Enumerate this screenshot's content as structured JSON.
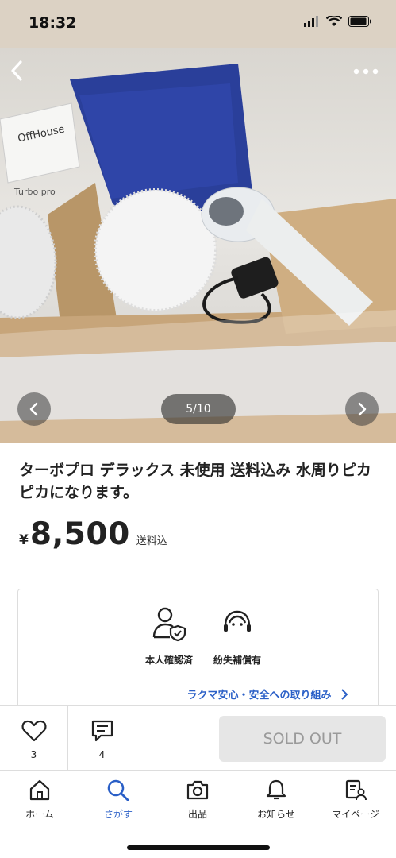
{
  "status_bar": {
    "time": "18:32"
  },
  "gallery": {
    "page_indicator": "5/10",
    "photo_text": {
      "logo_text": "OffHouse",
      "box_text": "Turbo pro"
    }
  },
  "item": {
    "title": "ターボプロ デラックス 未使用 送料込み 水周りピカピカになります。",
    "currency_symbol": "¥",
    "price": "8,500",
    "shipping_note": "送料込"
  },
  "safety": {
    "identity_label": "本人確認済",
    "compensation_label": "紛失補償有",
    "link_text": "ラクマ安心・安全への取り組み"
  },
  "actions": {
    "like_count": "3",
    "comment_count": "4",
    "sold_out_label": "SOLD OUT"
  },
  "tabs": {
    "home": "ホーム",
    "search": "さがす",
    "sell": "出品",
    "notifications": "お知らせ",
    "mypage": "マイページ"
  },
  "colors": {
    "accent": "#2a5fc7",
    "status_bar_bg": "#dcd2c4"
  }
}
